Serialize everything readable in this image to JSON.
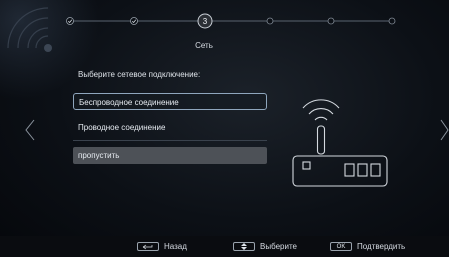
{
  "stepper": {
    "current_step_number": "3",
    "current_step_label": "Сеть",
    "total_steps": 7,
    "completed_steps": 2
  },
  "content": {
    "prompt": "Выберите сетевое подключение:",
    "options": [
      {
        "label": "Беспроводное соединение",
        "state": "focused"
      },
      {
        "label": "Проводное соединение",
        "state": "normal"
      },
      {
        "label": "пропустить",
        "state": "highlighted"
      }
    ]
  },
  "bottom_bar": {
    "back_label": "Назад",
    "back_icon": "return-arrow-icon",
    "select_label": "Выберите",
    "select_icon": "up-down-icon",
    "ok_key": "OK",
    "confirm_label": "Подтвердить"
  },
  "colors": {
    "focus_border": "#8fa6bd",
    "skip_bg": "#4d5157",
    "line": "#5a6470"
  }
}
